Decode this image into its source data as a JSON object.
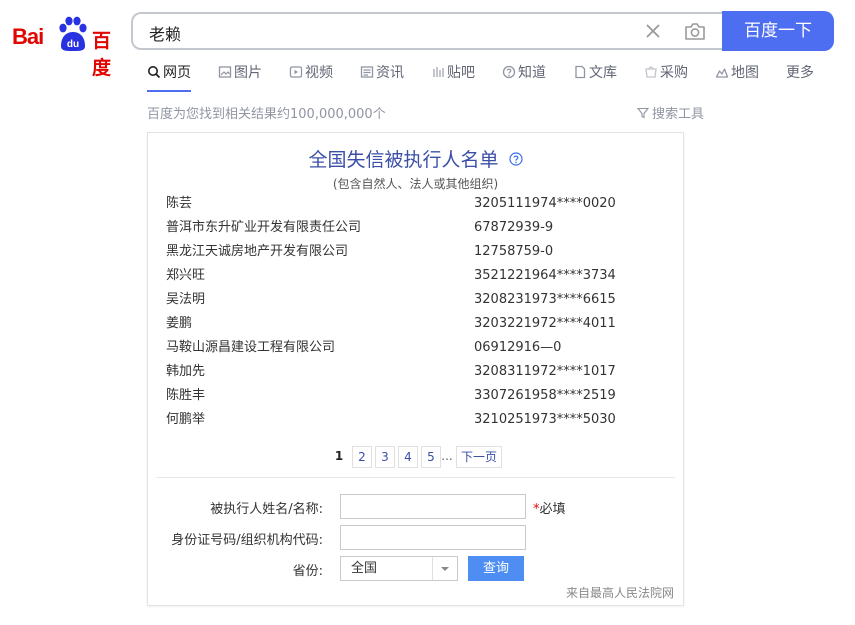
{
  "logo": {
    "text_left": "Bai",
    "text_right": "百度",
    "paw_text": "du"
  },
  "search": {
    "query": "老赖",
    "button_label": "百度一下"
  },
  "tabs": [
    {
      "label": "网页",
      "icon": "search-icon"
    },
    {
      "label": "图片",
      "icon": "image-icon"
    },
    {
      "label": "视频",
      "icon": "video-icon"
    },
    {
      "label": "资讯",
      "icon": "news-icon"
    },
    {
      "label": "贴吧",
      "icon": "tieba-icon"
    },
    {
      "label": "知道",
      "icon": "question-icon"
    },
    {
      "label": "文库",
      "icon": "document-icon"
    },
    {
      "label": "采购",
      "icon": "cart-icon"
    },
    {
      "label": "地图",
      "icon": "map-icon"
    }
  ],
  "more_label": "更多",
  "result_count": "百度为您找到相关结果约100,000,000个",
  "search_tools": "搜索工具",
  "card": {
    "title": "全国失信被执行人名单",
    "subtitle": "(包含自然人、法人或其他组织)",
    "rows": [
      {
        "name": "陈芸",
        "code": "3205111974****0020"
      },
      {
        "name": "普洱市东升矿业开发有限责任公司",
        "code": "67872939-9"
      },
      {
        "name": "黑龙江天诚房地产开发有限公司",
        "code": "12758759-0"
      },
      {
        "name": "郑兴旺",
        "code": "3521221964****3734"
      },
      {
        "name": "吴法明",
        "code": "3208231973****6615"
      },
      {
        "name": "姜鹏",
        "code": "3203221972****4011"
      },
      {
        "name": "马鞍山源昌建设工程有限公司",
        "code": "06912916—0"
      },
      {
        "name": "韩加先",
        "code": "3208311972****1017"
      },
      {
        "name": "陈胜丰",
        "code": "3307261958****2519"
      },
      {
        "name": "何鹏举",
        "code": "3210251973****5030"
      }
    ],
    "pager": {
      "pages": [
        "1",
        "2",
        "3",
        "4",
        "5"
      ],
      "ellipsis": "...",
      "next": "下一页"
    },
    "form": {
      "name_label": "被执行人姓名/名称:",
      "required_star": "*",
      "required_text": "必填",
      "id_label": "身份证号码/组织机构代码:",
      "province_label": "省份:",
      "province_value": "全国",
      "query_button": "查询"
    },
    "source": "来自最高人民法院网"
  },
  "colors": {
    "brand_red": "#e10602",
    "brand_blue": "#4e6ef2",
    "title_blue": "#3b4fa8"
  }
}
